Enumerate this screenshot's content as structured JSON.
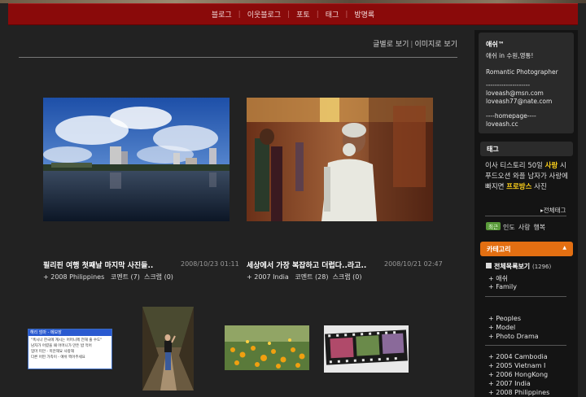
{
  "nav": {
    "items": [
      "블로그",
      "이웃블로그",
      "포토",
      "태그",
      "방명록"
    ]
  },
  "view_switch": {
    "text_view": "글별로 보기",
    "separator": "|",
    "image_view": "이미지로 보기"
  },
  "posts": [
    {
      "title": "필리핀 여행 첫째날 마지막 사진들..",
      "date": "2008/10/23 01:11",
      "category": "+ 2008 Philippines",
      "comments": "코멘트 (7)",
      "scrap": "스크랩 (0)"
    },
    {
      "title": "세상에서 가장 복잡하고 더럽다..라고..",
      "date": "2008/10/21 02:47",
      "category": "+ 2007 India",
      "comments": "코멘트 (28)",
      "scrap": "스크랩 (0)"
    }
  ],
  "sidebar": {
    "profile": {
      "name": "애쉬™",
      "lines": [
        "애쉬 in 수원,영통!",
        "Romantic Photographer",
        "--------------------",
        "loveash@msn.com",
        "loveash77@nate.com",
        "----homepage----",
        "loveash.cc"
      ]
    },
    "tag_header": "태그",
    "tags": {
      "t1": "이사",
      "t2": "티스토리",
      "t3": "50일",
      "t4": "사랑",
      "t5": "시푸드오션",
      "t6": "와플",
      "t7": "남자가",
      "t8": "사랑에",
      "t9": "빠지면",
      "t10": "프로방스",
      "t11": "사진"
    },
    "all_tags": "▸전체태그",
    "recent_badge": "최근",
    "recent_words": [
      "인도",
      "사랑",
      "행복"
    ],
    "category_header": "카테고리",
    "category_arrow": "▲",
    "category_all": "전체목록보기",
    "category_all_count": "(1296)",
    "categories_1": [
      "+ 애쉬",
      "+ Family"
    ],
    "categories_2": [
      "+ Peoples",
      "+ Model",
      "+ Photo Drama"
    ],
    "categories_3": [
      "+ 2004 Cambodia",
      "+ 2005 Vietnam I",
      "+ 2006 HongKong",
      "+ 2007 India",
      "+ 2008 Philippines"
    ]
  },
  "thumb_texts": {
    "win_title": "해리 엄마 - 메모장",
    "win_l1": "\"혹시나 한국에 계시는 어머니께 전해 줄 수도\"",
    "win_l2": "남자가 어렸을 때 어머니가 만든 밥 먹어",
    "win_l3": "엄마 미안 - 미안해요 사랑해",
    "win_l4": "다른 어떤 가족이 - 애쉬 찍어주세요"
  },
  "colors": {
    "nav_bg": "#8a0a0a",
    "accent_orange": "#e36f12",
    "tag_highlight": "#ffd21a",
    "body_bg": "#222222",
    "sidebar_bg": "#141414"
  }
}
